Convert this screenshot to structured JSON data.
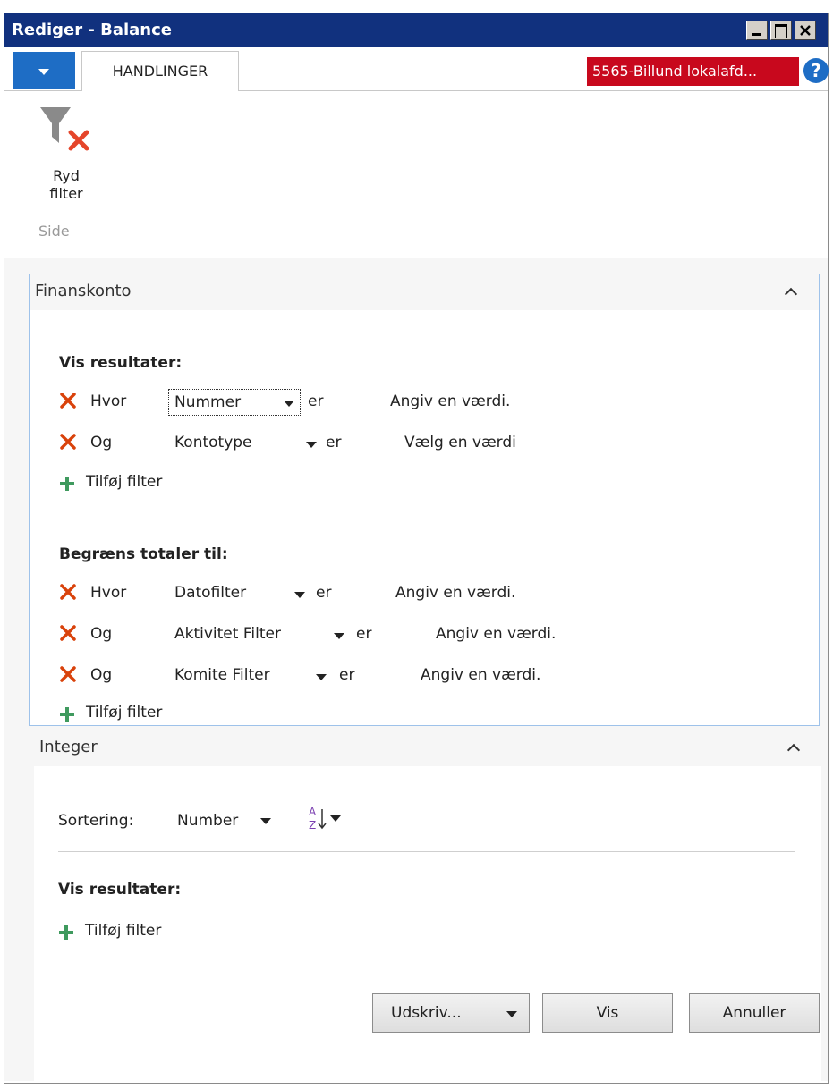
{
  "window": {
    "title": "Rediger - Balance"
  },
  "ribbon": {
    "tab": "HANDLINGER",
    "company": "5565-Billund lokalafd...",
    "help": "?",
    "clear_filter_label_1": "Ryd",
    "clear_filter_label_2": "filter",
    "group_label": "Side"
  },
  "finanskonto": {
    "header": "Finanskonto",
    "show_results_title": "Vis resultater:",
    "show_filters": [
      {
        "conj": "Hvor",
        "field": "Nummer",
        "op": "er",
        "value": "Angiv en værdi."
      },
      {
        "conj": "Og",
        "field": "Kontotype",
        "op": "er",
        "value": "Vælg en værdi"
      }
    ],
    "add_filter_1": "Tilføj filter",
    "limit_totals_title": "Begræns totaler til:",
    "limit_filters": [
      {
        "conj": "Hvor",
        "field": "Datofilter",
        "op": "er",
        "value": "Angiv en værdi."
      },
      {
        "conj": "Og",
        "field": "Aktivitet Filter",
        "op": "er",
        "value": "Angiv en værdi."
      },
      {
        "conj": "Og",
        "field": "Komite Filter",
        "op": "er",
        "value": "Angiv en værdi."
      }
    ],
    "add_filter_2": "Tilføj filter"
  },
  "integer": {
    "header": "Integer",
    "sort_label": "Sortering:",
    "sort_value": "Number",
    "show_results_title": "Vis resultater:",
    "add_filter": "Tilføj filter"
  },
  "buttons": {
    "print": "Udskriv...",
    "show": "Vis",
    "cancel": "Annuller"
  },
  "colors": {
    "titlebar": "#11317e",
    "accent": "#1e6dc5",
    "company_badge": "#c8081d",
    "delete_x": "#d9420b",
    "add_plus": "#3f9a5e"
  }
}
